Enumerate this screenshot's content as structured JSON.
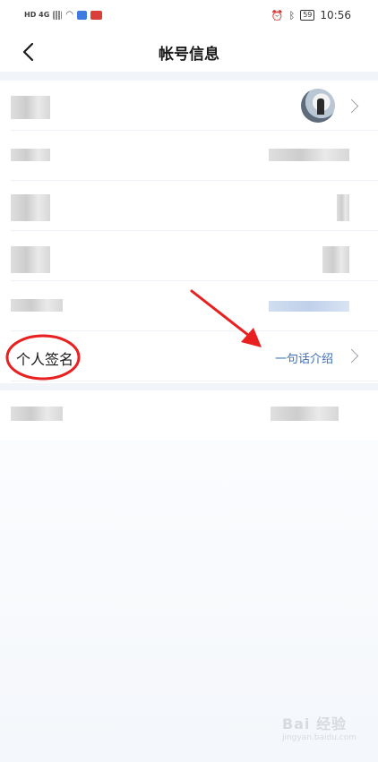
{
  "status_bar": {
    "left_text": "HD 4G",
    "time": "10:56",
    "battery": "59"
  },
  "header": {
    "title": "帐号信息",
    "back_icon": "chevron-left-icon"
  },
  "rows": {
    "signature_label": "个人签名",
    "signature_value": "一句话介绍"
  },
  "watermark": {
    "text": "Bai 经验",
    "sub": "jingyan.baidu.com"
  },
  "colors": {
    "accent_link": "#3e6fb8",
    "annotation_red": "#e8201f",
    "section_band": "#f1f5fa"
  }
}
